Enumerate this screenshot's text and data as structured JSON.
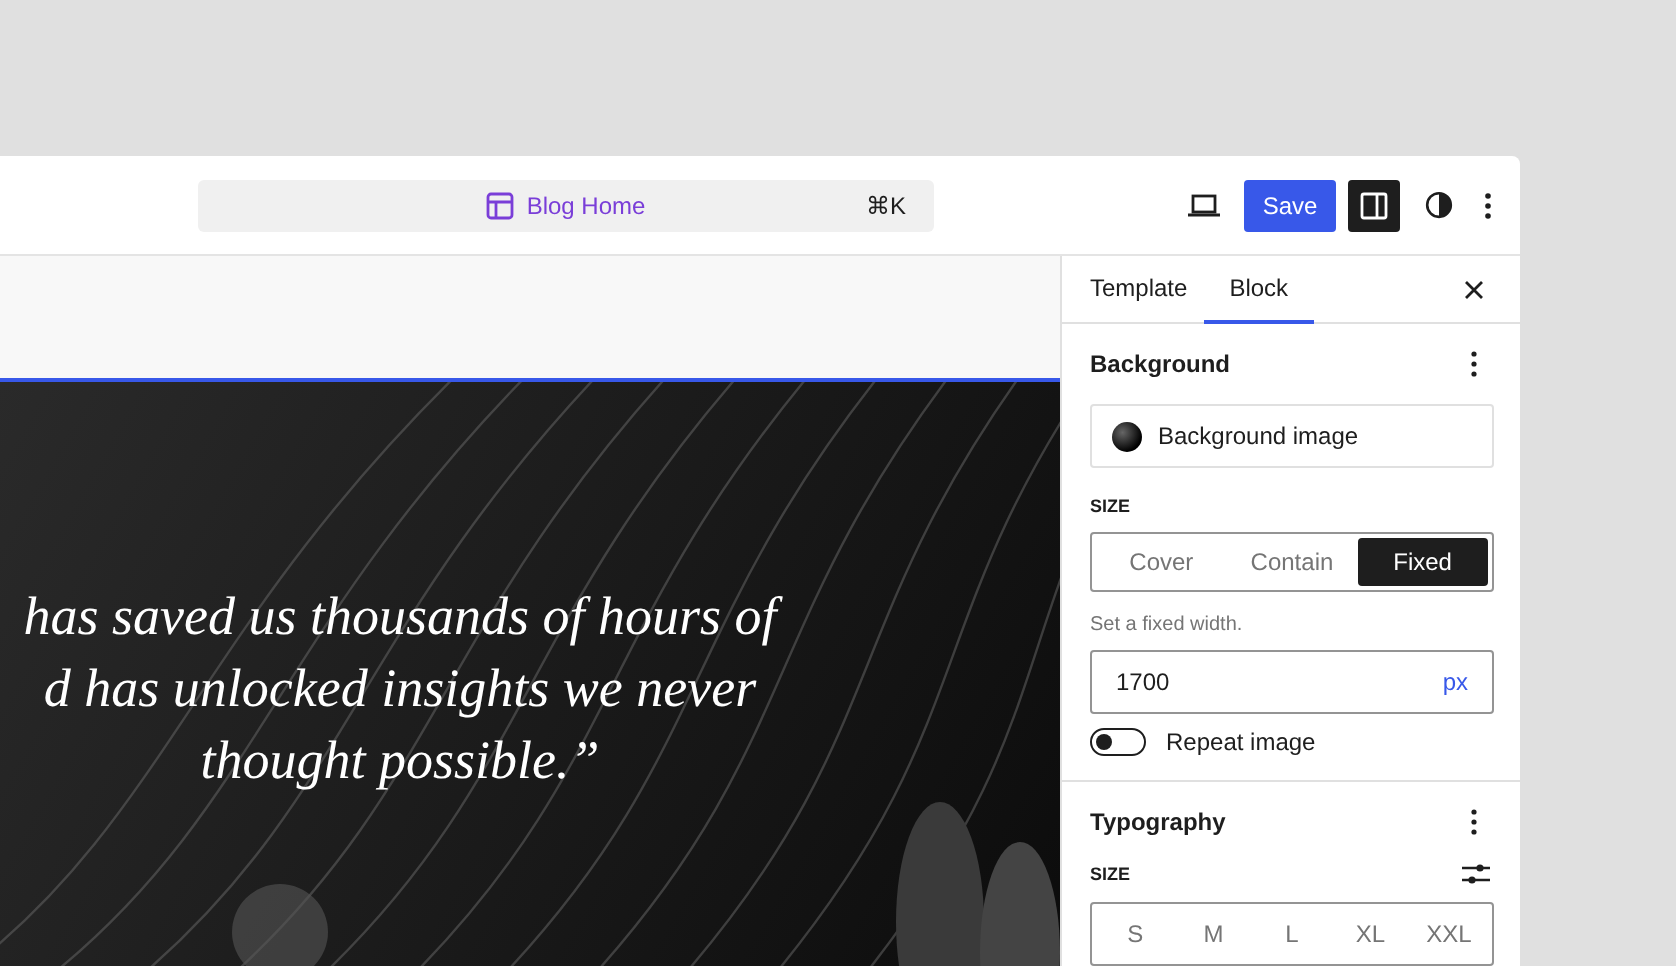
{
  "toolbar": {
    "command_bar": {
      "title": "Blog Home",
      "shortcut": "⌘K"
    },
    "save_button": "Save",
    "sidebar_toggle": {
      "on": true
    }
  },
  "canvas": {
    "quote_lines": [
      "has saved us thousands of hours of",
      "d has unlocked insights we never",
      "thought possible.”"
    ]
  },
  "sidebar": {
    "tabs": [
      {
        "label": "Template",
        "selected": false
      },
      {
        "label": "Block",
        "selected": true
      }
    ],
    "background": {
      "title": "Background",
      "image_label": "Background image",
      "size_label": "SIZE",
      "size_options": [
        {
          "label": "Cover",
          "selected": false
        },
        {
          "label": "Contain",
          "selected": false
        },
        {
          "label": "Fixed",
          "selected": true
        }
      ],
      "help": "Set a fixed width.",
      "width": {
        "value": "1700",
        "unit": "px"
      },
      "repeat": {
        "label": "Repeat image",
        "on": false
      }
    },
    "typography": {
      "title": "Typography",
      "size_label": "SIZE",
      "size_options": [
        {
          "label": "S",
          "selected": false
        },
        {
          "label": "M",
          "selected": false
        },
        {
          "label": "L",
          "selected": false
        },
        {
          "label": "XL",
          "selected": false
        },
        {
          "label": "XXL",
          "selected": false
        }
      ]
    }
  }
}
